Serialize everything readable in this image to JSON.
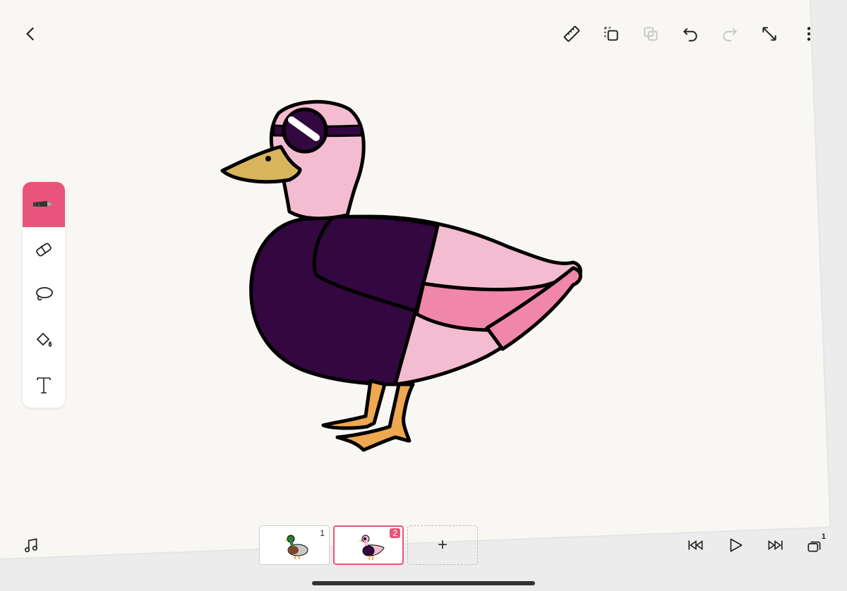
{
  "top_bar": {
    "back": "chevron-left-icon",
    "actions": [
      "ruler-icon",
      "duplicate-icon",
      "copy-icon",
      "undo-icon",
      "redo-icon",
      "expand-icon",
      "more-icon"
    ]
  },
  "tools": [
    "pen-icon",
    "eraser-icon",
    "lasso-icon",
    "fill-bucket-icon",
    "text-icon"
  ],
  "active_tool": "pen",
  "accent_color": "#e9557a",
  "frames": [
    {
      "number": "1",
      "selected": false
    },
    {
      "number": "2",
      "selected": true
    }
  ],
  "add_frame_label": "+",
  "bottom_bar": {
    "left": "music-icon",
    "right": [
      "skip-back-icon",
      "play-icon",
      "skip-forward-icon",
      "layers-icon"
    ]
  },
  "layers_badge": "1",
  "duck_colors": {
    "head": "#f4bcd0",
    "body_dark": "#33073f",
    "wing_pink": "#f087aa",
    "beak": "#d8b45c",
    "feet": "#eea84f",
    "outline": "#000000"
  }
}
